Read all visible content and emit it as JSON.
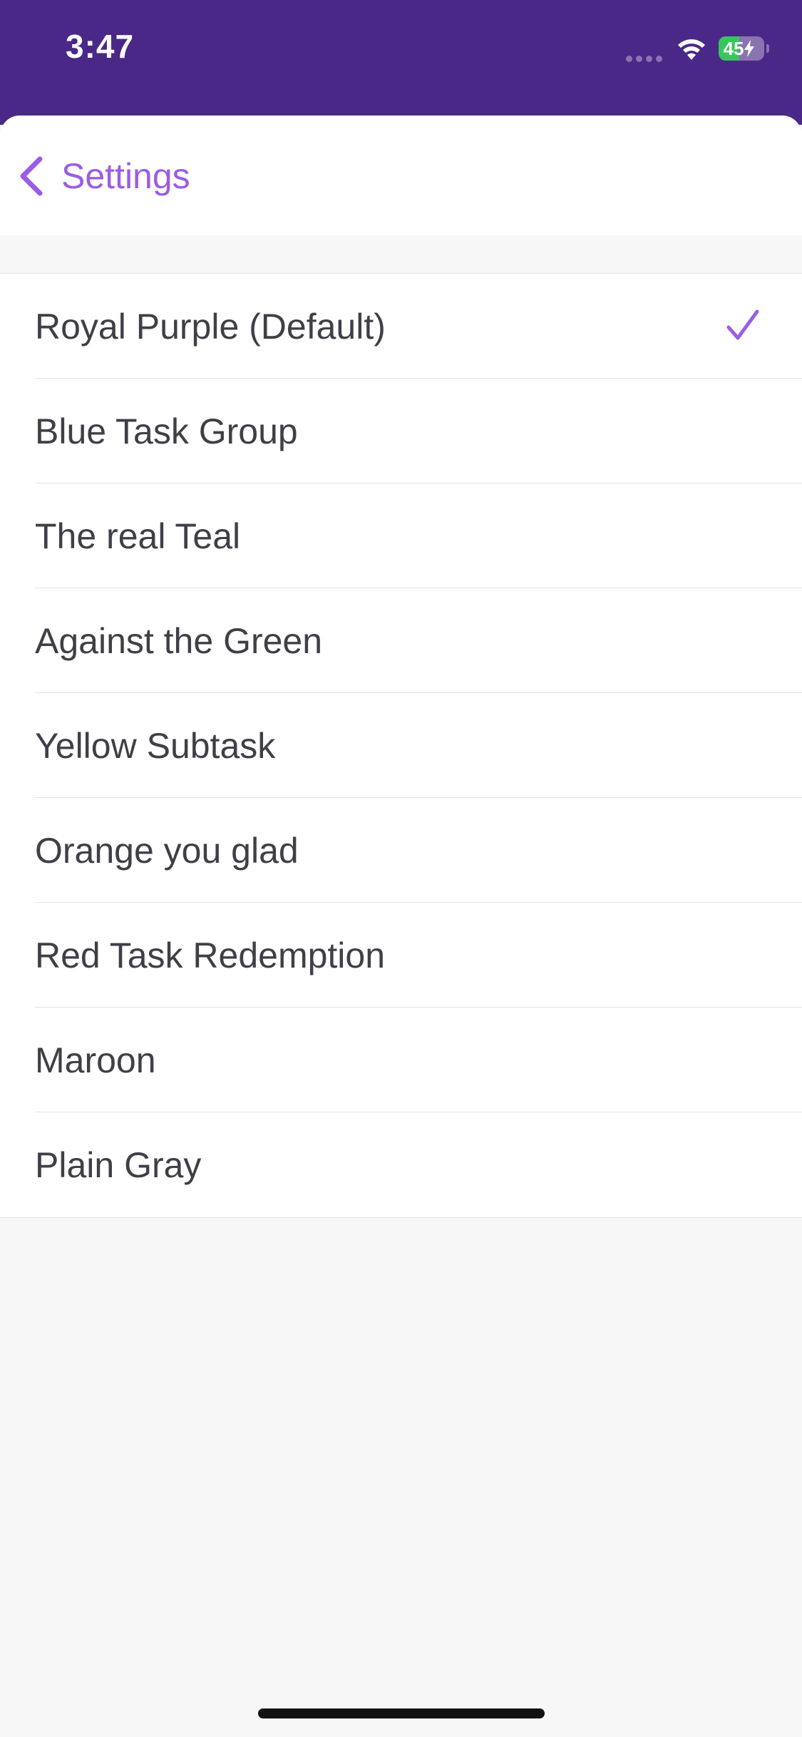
{
  "status_bar": {
    "time": "3:47",
    "battery_level": "45",
    "battery_fraction": 0.45,
    "wifi_icon": "wifi-icon",
    "charging_icon": "bolt-icon"
  },
  "nav": {
    "back_label": "Settings",
    "back_icon": "chevron-left-icon"
  },
  "colors": {
    "status_bar_bg": "#4a2888",
    "accent": "#9b5de5",
    "battery_green": "#34c759",
    "row_text": "#3f3f47"
  },
  "themes": {
    "selected_index": 0,
    "items": [
      {
        "label": "Royal Purple (Default)",
        "selected": true
      },
      {
        "label": "Blue Task Group",
        "selected": false
      },
      {
        "label": "The real Teal",
        "selected": false
      },
      {
        "label": "Against the Green",
        "selected": false
      },
      {
        "label": "Yellow Subtask",
        "selected": false
      },
      {
        "label": "Orange you glad",
        "selected": false
      },
      {
        "label": "Red Task Redemption",
        "selected": false
      },
      {
        "label": "Maroon",
        "selected": false
      },
      {
        "label": "Plain Gray",
        "selected": false
      }
    ]
  }
}
